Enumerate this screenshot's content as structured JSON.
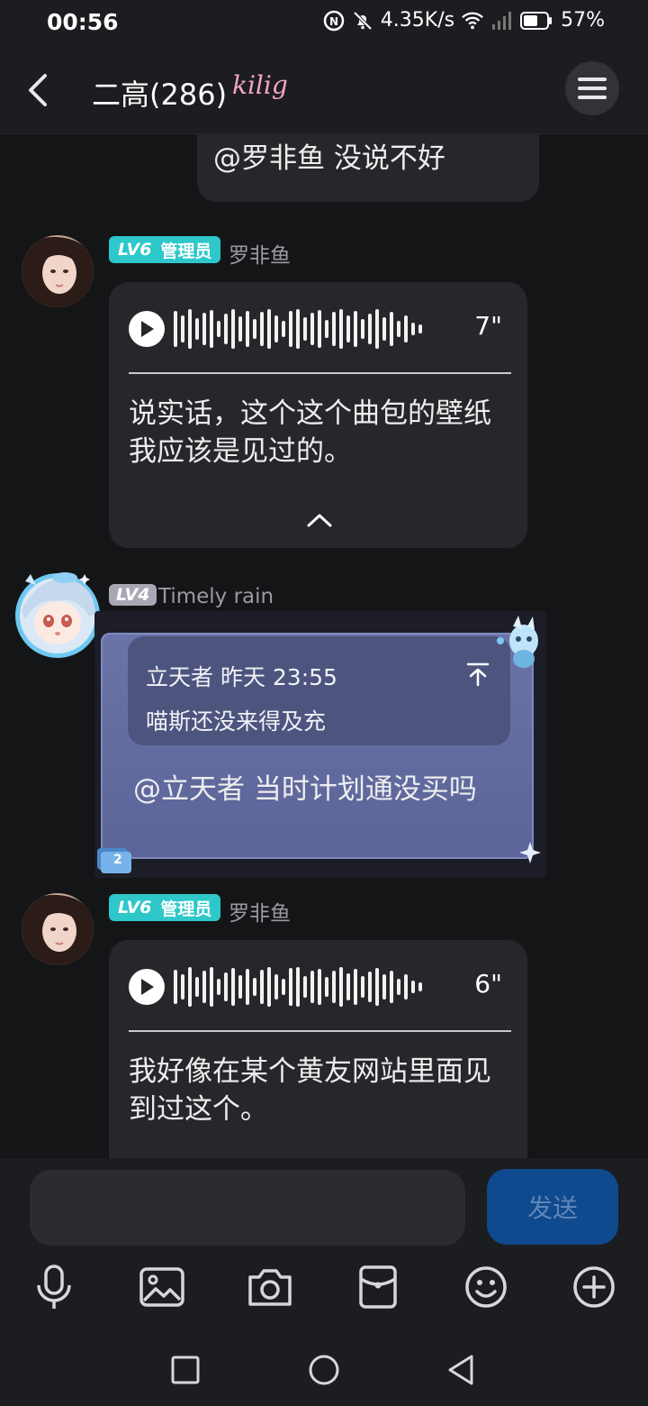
{
  "status_bar": {
    "time": "00:56",
    "speed": "4.35K/s",
    "battery": "57%"
  },
  "header": {
    "title": "二高(286)",
    "badge": "kilig"
  },
  "messages": [
    {
      "text": "@罗非鱼 没说不好"
    },
    {
      "level": "LV6",
      "role": "管理员",
      "name": "罗非鱼",
      "voice_duration": "7\"",
      "transcript": "说实话，这个这个曲包的壁纸我应该是见过的。"
    },
    {
      "level": "LV4",
      "name": "Timely rain",
      "quote_header": "立天者 昨天 23:55",
      "quote_text": "喵斯还没来得及充",
      "text": "@立天者 当时计划通没买吗",
      "badge_num": "2"
    },
    {
      "level": "LV6",
      "role": "管理员",
      "name": "罗非鱼",
      "voice_duration": "6\"",
      "transcript": "我好像在某个黄友网站里面见到过这个。"
    }
  ],
  "composer": {
    "send_label": "发送",
    "placeholder": ""
  },
  "icons": {
    "back": "chevron-left-icon",
    "menu": "hamburger-menu-icon",
    "voice": "microphone-icon",
    "image": "image-icon",
    "camera": "camera-icon",
    "redpacket": "red-packet-icon",
    "emoji": "emoji-icon",
    "more": "plus-circle-icon"
  },
  "colors": {
    "admin_badge": "#2ec7ca",
    "lv4_badge": "#a7a8b3",
    "send_button": "#0f4a8e",
    "accent_badge": "#f6a4c9"
  }
}
